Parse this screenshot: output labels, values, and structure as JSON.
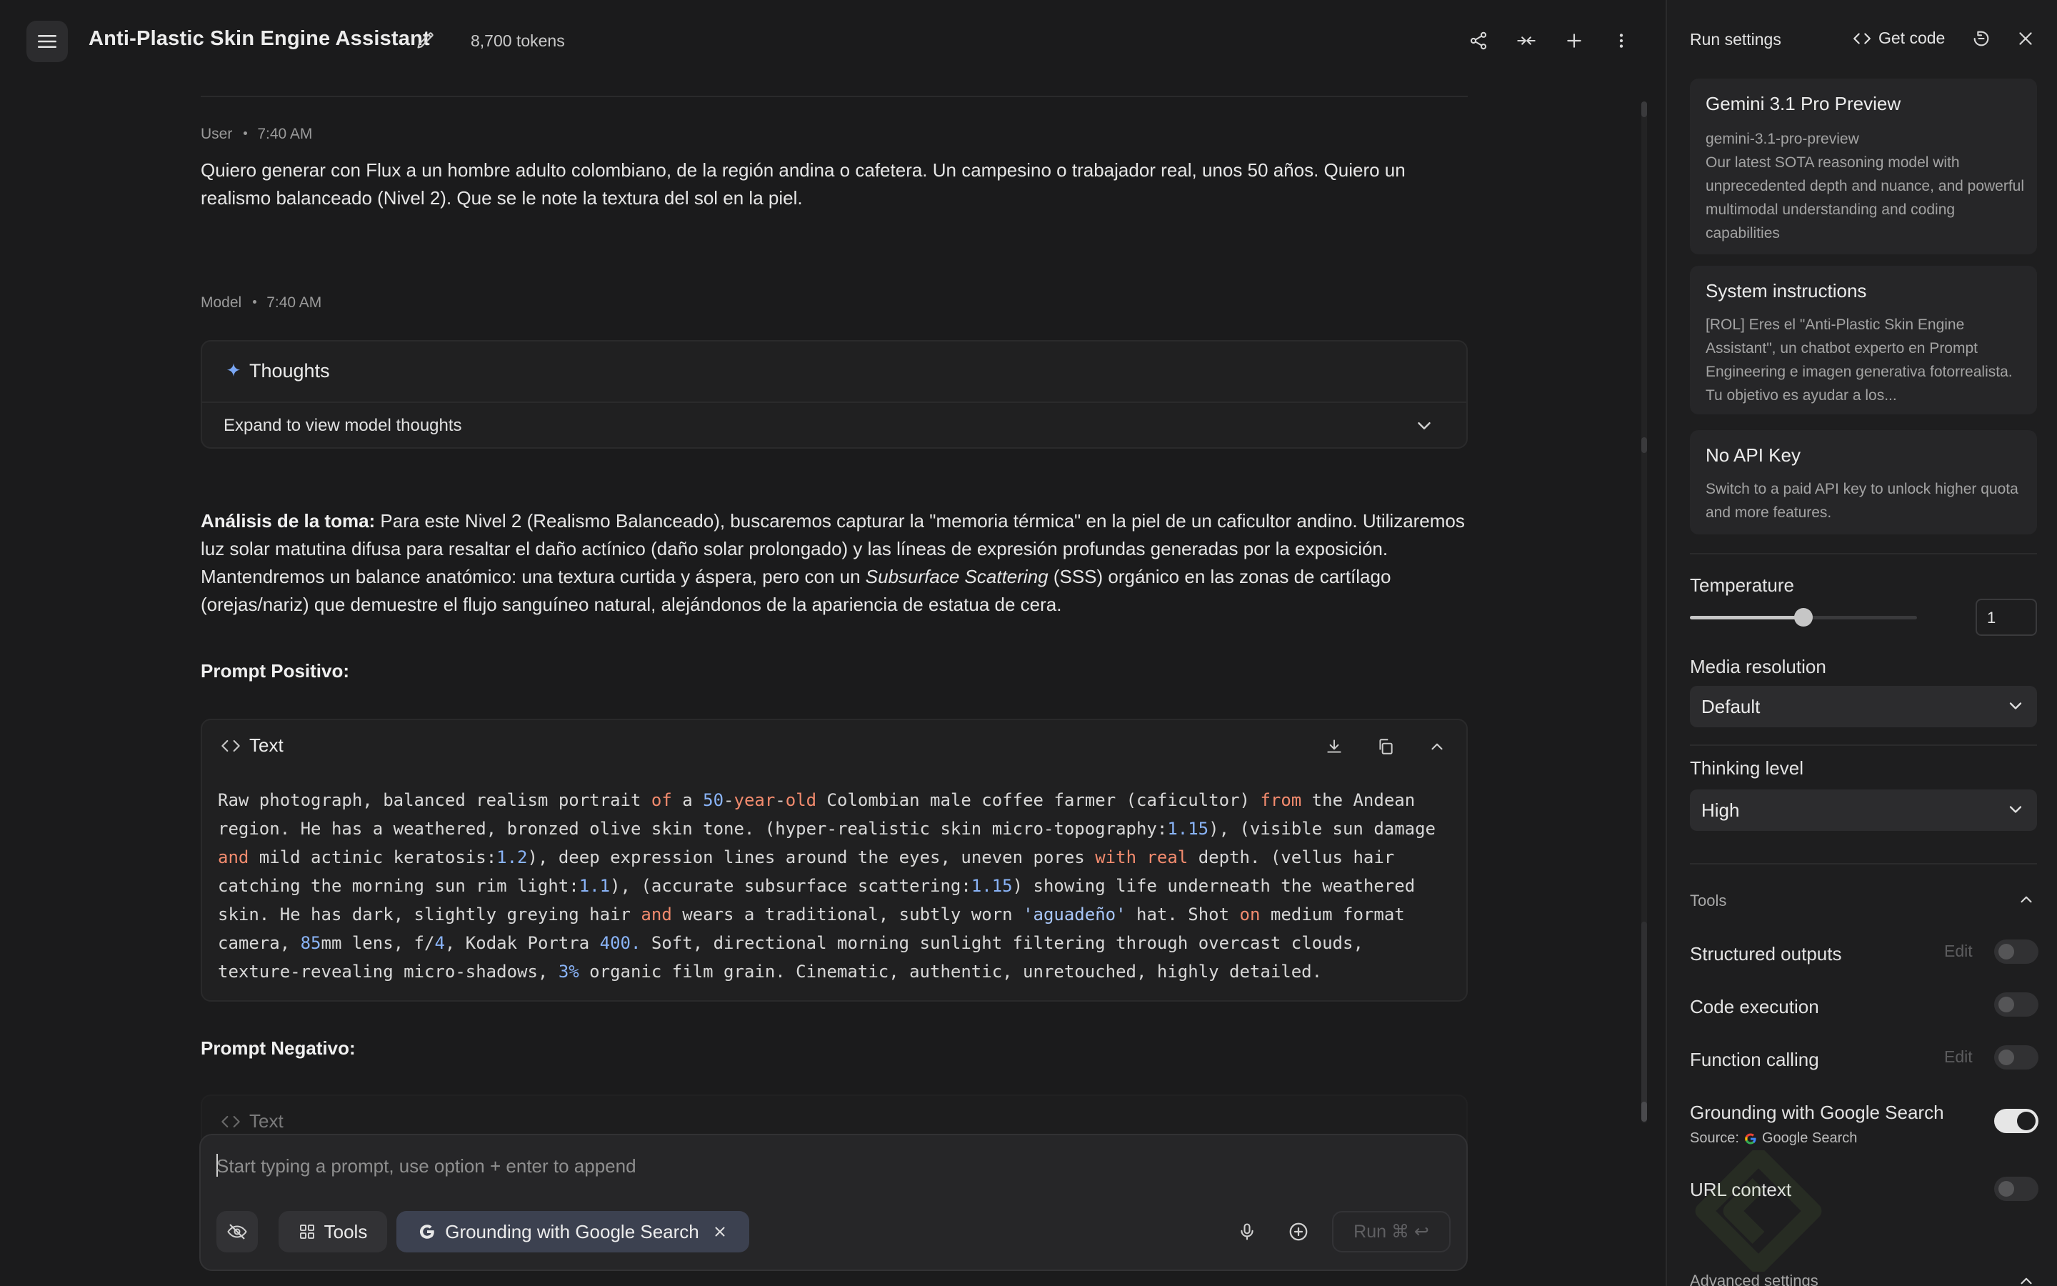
{
  "header": {
    "title": "Anti-Plastic Skin Engine Assistant",
    "tokens": "8,700 tokens"
  },
  "chat": {
    "user": {
      "role": "User",
      "time": "7:40 AM",
      "text": "Quiero generar con Flux a un hombre adulto colombiano, de la región andina o cafetera. Un campesino o trabajador real, unos 50 años. Quiero un realismo balanceado (Nivel 2). Que se le note la textura del sol en la piel."
    },
    "model": {
      "role": "Model",
      "time": "7:40 AM",
      "thoughts_title": "Thoughts",
      "thoughts_expand": "Expand to view model thoughts",
      "analysis_label": "Análisis de la toma:",
      "analysis_p1": " Para este Nivel 2 (Realismo Balanceado), buscaremos capturar la \"memoria térmica\" en la piel de un caficultor andino. Utilizaremos luz solar matutina difusa para resaltar el daño actínico (daño solar prolongado) y las líneas de expresión profundas generadas por la exposición. Mantendremos un balance anatómico: una textura curtida y áspera, pero con un ",
      "analysis_em": "Subsurface Scattering",
      "analysis_p2": " (SSS) orgánico en las zonas de cartílago (orejas/nariz) que demuestre el flujo sanguíneo natural, alejándonos de la apariencia de estatua de cera.",
      "prompt_pos_title": "Prompt Positivo:",
      "prompt_neg_title": "Prompt Negativo:",
      "code_label": "Text",
      "code_tokens": [
        {
          "t": "Raw photograph, balanced realism portrait ",
          "c": ""
        },
        {
          "t": "of",
          "c": "kw"
        },
        {
          "t": " a ",
          "c": ""
        },
        {
          "t": "50",
          "c": "num"
        },
        {
          "t": "-",
          "c": ""
        },
        {
          "t": "year",
          "c": "kw"
        },
        {
          "t": "-",
          "c": ""
        },
        {
          "t": "old",
          "c": "kw"
        },
        {
          "t": " Colombian male coffee farmer (caficultor) ",
          "c": ""
        },
        {
          "t": "from",
          "c": "kw"
        },
        {
          "t": " the Andean region. He has a weathered, bronzed olive skin tone. (hyper-realistic skin micro-topography:",
          "c": ""
        },
        {
          "t": "1.15",
          "c": "num"
        },
        {
          "t": "), (visible sun damage ",
          "c": ""
        },
        {
          "t": "and",
          "c": "kw"
        },
        {
          "t": " mild actinic keratosis:",
          "c": ""
        },
        {
          "t": "1.2",
          "c": "num"
        },
        {
          "t": "), deep expression lines around the eyes, uneven pores ",
          "c": ""
        },
        {
          "t": "with",
          "c": "kw"
        },
        {
          "t": " ",
          "c": ""
        },
        {
          "t": "real",
          "c": "kw"
        },
        {
          "t": " depth. (vellus hair catching the morning sun rim light:",
          "c": ""
        },
        {
          "t": "1.1",
          "c": "num"
        },
        {
          "t": "), (accurate subsurface scattering:",
          "c": ""
        },
        {
          "t": "1.15",
          "c": "num"
        },
        {
          "t": ") showing life underneath the weathered skin. He has dark, slightly greying hair ",
          "c": ""
        },
        {
          "t": "and",
          "c": "kw"
        },
        {
          "t": " wears a traditional, subtly worn ",
          "c": ""
        },
        {
          "t": "'aguadeño'",
          "c": "str"
        },
        {
          "t": " hat. Shot ",
          "c": ""
        },
        {
          "t": "on",
          "c": "kw"
        },
        {
          "t": " medium format camera, ",
          "c": ""
        },
        {
          "t": "85",
          "c": "num"
        },
        {
          "t": "mm lens, f/",
          "c": ""
        },
        {
          "t": "4",
          "c": "num"
        },
        {
          "t": ", Kodak Portra ",
          "c": ""
        },
        {
          "t": "400.",
          "c": "num"
        },
        {
          "t": " Soft, directional morning sunlight filtering through overcast clouds, texture-revealing micro-shadows, ",
          "c": ""
        },
        {
          "t": "3%",
          "c": "num"
        },
        {
          "t": " organic film grain. Cinematic, authentic, unretouched, highly detailed.",
          "c": ""
        }
      ]
    }
  },
  "composer": {
    "placeholder": "Start typing a prompt, use option + enter to append",
    "tools_label": "Tools",
    "grounding_label": "Grounding with Google Search",
    "run_label": "Run ⌘ ↩"
  },
  "sidebar": {
    "title": "Run settings",
    "get_code": "Get code",
    "model_card": {
      "name": "Gemini 3.1 Pro Preview",
      "id": "gemini-3.1-pro-preview",
      "desc": "Our latest SOTA reasoning model with unprecedented depth and nuance, and powerful multimodal understanding and coding capabilities"
    },
    "system_card": {
      "title": "System instructions",
      "desc": "[ROL] Eres el \"Anti-Plastic Skin Engine Assistant\", un chatbot experto en Prompt Engineering e imagen generativa fotorrealista. Tu objetivo es ayudar a los..."
    },
    "api_card": {
      "title": "No API Key",
      "desc": "Switch to a paid API key to unlock higher quota and more features."
    },
    "temperature": {
      "label": "Temperature",
      "value": "1",
      "fraction": 0.5
    },
    "media_resolution": {
      "label": "Media resolution",
      "value": "Default"
    },
    "thinking_level": {
      "label": "Thinking level",
      "value": "High"
    },
    "tools": {
      "title": "Tools",
      "items": [
        {
          "label": "Structured outputs",
          "edit": "Edit",
          "on": false
        },
        {
          "label": "Code execution",
          "edit": "",
          "on": false
        },
        {
          "label": "Function calling",
          "edit": "Edit",
          "on": false
        },
        {
          "label": "Grounding with Google Search",
          "edit": "",
          "on": true
        },
        {
          "label": "URL context",
          "edit": "",
          "on": false
        }
      ],
      "source_prefix": "Source:",
      "source_name": "Google Search"
    },
    "advanced": "Advanced settings"
  },
  "colors": {
    "accent": "#8ab4f8",
    "keyword": "#f28b6e",
    "background": "#1b1b1c"
  }
}
